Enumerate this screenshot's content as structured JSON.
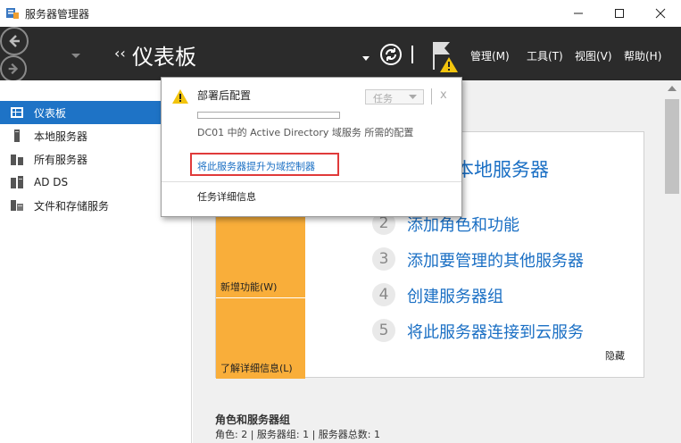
{
  "window": {
    "title": "服务器管理器"
  },
  "header": {
    "breadcrumb_chevron": "‹‹",
    "breadcrumb": "仪表板",
    "menus": [
      {
        "label": "管理(M)"
      },
      {
        "label": "工具(T)"
      },
      {
        "label": "视图(V)"
      },
      {
        "label": "帮助(H)"
      }
    ]
  },
  "sidebar": {
    "items": [
      {
        "label": "仪表板",
        "icon": "dashboard-icon",
        "active": true
      },
      {
        "label": "本地服务器",
        "icon": "server-icon"
      },
      {
        "label": "所有服务器",
        "icon": "servers-icon"
      },
      {
        "label": "AD DS",
        "icon": "ad-ds-icon"
      },
      {
        "label": "文件和存储服务",
        "icon": "file-storage-icon"
      }
    ]
  },
  "popup": {
    "title": "部署后配置",
    "task_button": "任务",
    "close": "x",
    "progress": 0,
    "description": "DC01 中的 Active Directory 域服务 所需的配置",
    "action_link": "将此服务器提升为域控制器",
    "details_link": "任务详细信息"
  },
  "welcome": {
    "heading_partial": "本地服务器",
    "tiles": {
      "new_features": "新增功能(W)",
      "learn_more": "了解详细信息(L)"
    },
    "steps": [
      {
        "num": "2",
        "label": "添加角色和功能"
      },
      {
        "num": "3",
        "label": "添加要管理的其他服务器"
      },
      {
        "num": "4",
        "label": "创建服务器组"
      },
      {
        "num": "5",
        "label": "将此服务器连接到云服务"
      }
    ],
    "hide": "隐藏"
  },
  "roles": {
    "title": "角色和服务器组",
    "summary": "角色: 2 | 服务器组: 1 | 服务器总数: 1"
  },
  "colors": {
    "accent": "#1e73c6",
    "tile": "#f9ae3a",
    "header": "#2b2b2b",
    "highlight": "#e03a3a",
    "link": "#1a6fc4"
  }
}
